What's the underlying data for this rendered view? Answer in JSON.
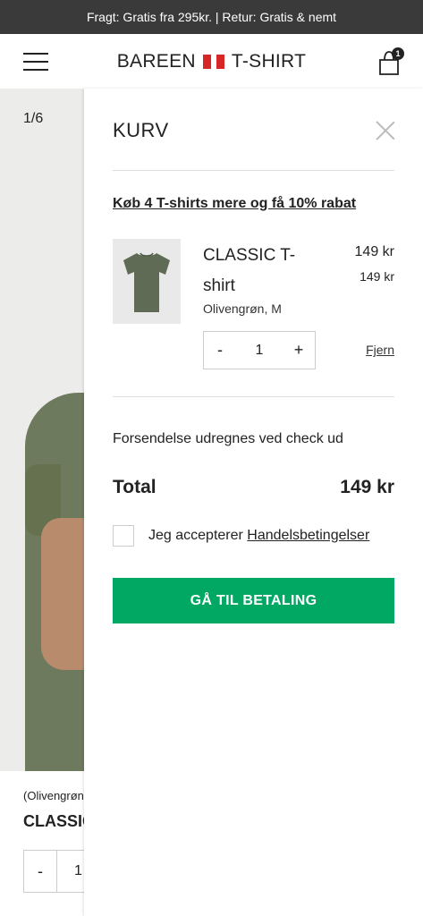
{
  "topbar": {
    "text": "Fragt: Gratis fra 295kr. | Retur: Gratis & nemt"
  },
  "header": {
    "brand_left": "BAREEN",
    "brand_right": "T-SHIRT",
    "cart_count": "1"
  },
  "background_page": {
    "image_counter": "1/6",
    "variant_label": "(Olivengrøn",
    "product_title": "CLASSIC",
    "quantity": "1",
    "minus_label": "-"
  },
  "cart": {
    "title": "KURV",
    "promo_text": "Køb 4 T-shirts mere og få 10% rabat",
    "item": {
      "name": "CLASSIC T-shirt",
      "variant": "Olivengrøn, M",
      "price": "149 kr",
      "unit_price": "149 kr",
      "quantity": "1",
      "minus_label": "-",
      "plus_label": "+",
      "remove_label": "Fjern",
      "shirt_color": "#5f6b55"
    },
    "shipping_note": "Forsendelse udregnes ved check ud",
    "total_label": "Total",
    "total_value": "149 kr",
    "terms_prefix": "Jeg accepterer",
    "terms_link": "Handelsbetingelser",
    "checkout_label": "GÅ TIL BETALING"
  },
  "colors": {
    "topbar_bg": "#3a3a3a",
    "checkout_bg": "#00a864",
    "flag_red": "#d62626"
  }
}
